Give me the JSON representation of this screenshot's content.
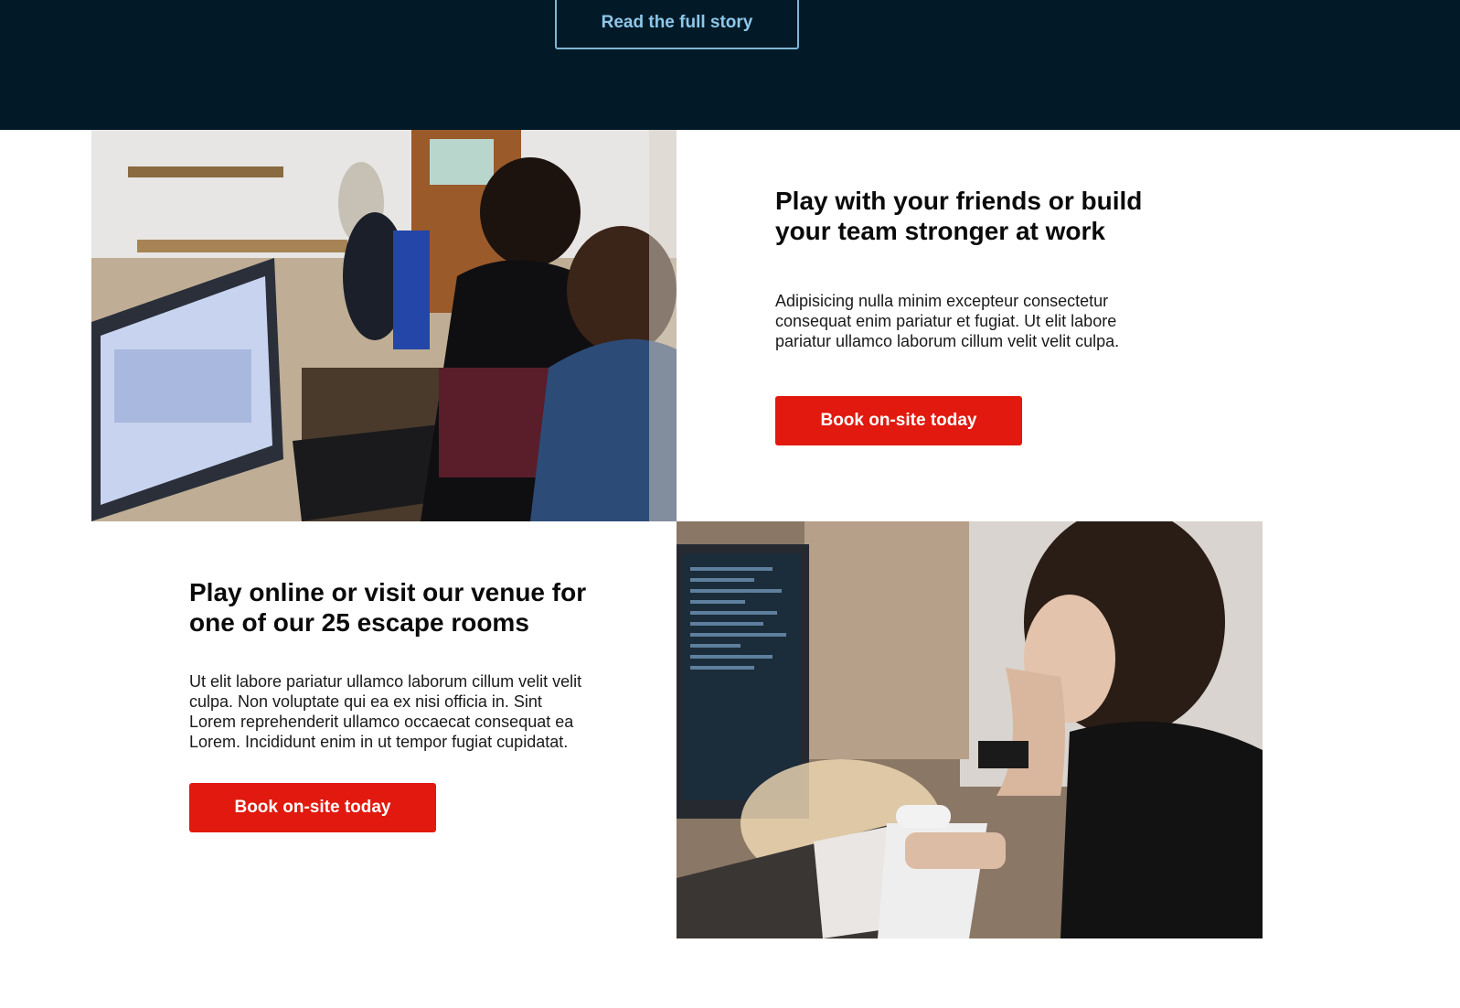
{
  "hero": {
    "read_story_label": "Read the full story"
  },
  "features": [
    {
      "heading": "Play with your friends or build your team stronger at work",
      "body": "Adipisicing nulla minim excepteur consectetur consequat enim pariatur et fugiat. Ut elit labore pariatur ullamco laborum cillum velit velit culpa.",
      "cta_label": "Book on-site today",
      "image_alt": "team-working-on-laptop-photo"
    },
    {
      "heading": "Play online or visit our venue for one of our 25 escape rooms",
      "body": "Ut elit labore pariatur ullamco laborum cillum velit velit culpa. Non voluptate qui ea ex nisi officia in. Sint Lorem reprehenderit ullamco occaecat consequat ea Lorem. Incididunt enim in ut tempor fugiat cupidatat.",
      "cta_label": "Book on-site today",
      "image_alt": "woman-coding-at-desk-photo"
    }
  ],
  "colors": {
    "hero_background": "#021a28",
    "outline_button": "#8ec7ea",
    "cta_background": "#e1190e",
    "cta_text": "#ffffff"
  }
}
